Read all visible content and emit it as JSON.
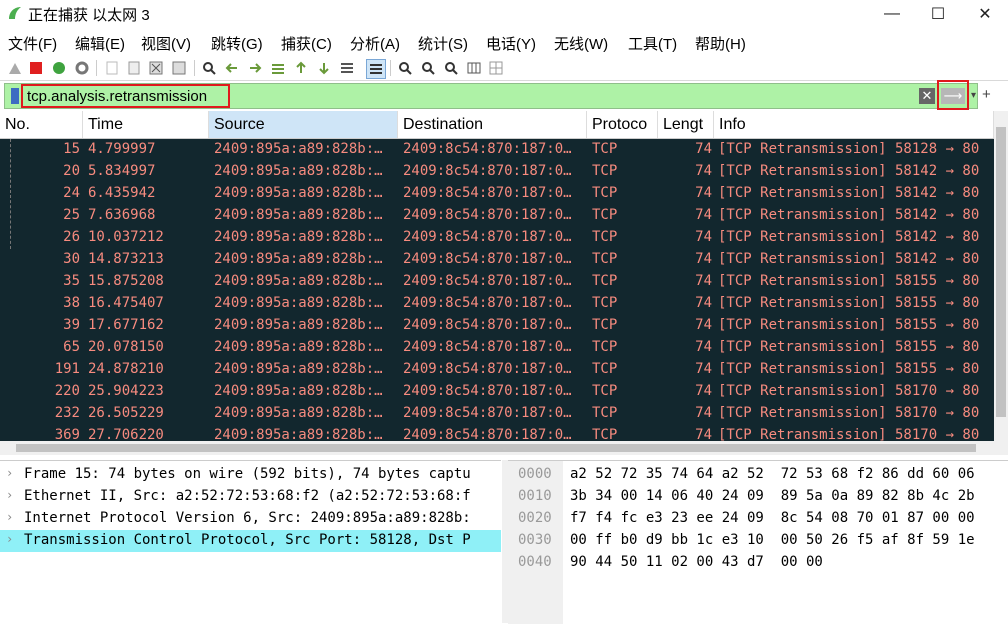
{
  "window": {
    "title": "正在捕获 以太网 3",
    "minimize": "—",
    "maximize": "☐",
    "close": "✕"
  },
  "menu": [
    "文件(F)",
    "编辑(E)",
    "视图(V)",
    "跳转(G)",
    "捕获(C)",
    "分析(A)",
    "统计(S)",
    "电话(Y)",
    "无线(W)",
    "工具(T)",
    "帮助(H)"
  ],
  "toolbar_icons": [
    "shark-fin-start-icon",
    "stop-icon",
    "restart-icon",
    "options-gear-icon",
    "open-file-icon",
    "save-file-icon",
    "close-file-icon",
    "reload-icon",
    "search-icon",
    "back-arrow-icon",
    "forward-arrow-icon",
    "goto-packet-icon",
    "first-packet-icon",
    "last-packet-icon",
    "autoscroll-icon",
    "colorize-icon",
    "zoom-in-icon",
    "zoom-out-icon",
    "zoom-reset-icon",
    "resize-columns-icon",
    "layout-icon"
  ],
  "filter": {
    "value": "tcp.analysis.retransmission",
    "clear_glyph": "✕",
    "apply_glyph": "⟶",
    "dropdown_glyph": "▾",
    "add_glyph": "+"
  },
  "colors": {
    "filter_bg": "#aef2a6",
    "row_bg": "#12272e",
    "row_fg": "#f78b7f",
    "selected_detail_bg": "#8ff0f7",
    "highlight_box": "#e0191d"
  },
  "columns": [
    "No.",
    "Time",
    "Source",
    "Destination",
    "Protoco",
    "Lengt",
    "Info"
  ],
  "packets": [
    {
      "no": "15",
      "time": "4.799997",
      "source": "2409:895a:a89:828b:…",
      "destination": "2409:8c54:870:187:0…",
      "protocol": "TCP",
      "length": "74",
      "info": "[TCP Retransmission] 58128 → 80"
    },
    {
      "no": "20",
      "time": "5.834997",
      "source": "2409:895a:a89:828b:…",
      "destination": "2409:8c54:870:187:0…",
      "protocol": "TCP",
      "length": "74",
      "info": "[TCP Retransmission] 58142 → 80"
    },
    {
      "no": "24",
      "time": "6.435942",
      "source": "2409:895a:a89:828b:…",
      "destination": "2409:8c54:870:187:0…",
      "protocol": "TCP",
      "length": "74",
      "info": "[TCP Retransmission] 58142 → 80"
    },
    {
      "no": "25",
      "time": "7.636968",
      "source": "2409:895a:a89:828b:…",
      "destination": "2409:8c54:870:187:0…",
      "protocol": "TCP",
      "length": "74",
      "info": "[TCP Retransmission] 58142 → 80"
    },
    {
      "no": "26",
      "time": "10.037212",
      "source": "2409:895a:a89:828b:…",
      "destination": "2409:8c54:870:187:0…",
      "protocol": "TCP",
      "length": "74",
      "info": "[TCP Retransmission] 58142 → 80"
    },
    {
      "no": "30",
      "time": "14.873213",
      "source": "2409:895a:a89:828b:…",
      "destination": "2409:8c54:870:187:0…",
      "protocol": "TCP",
      "length": "74",
      "info": "[TCP Retransmission] 58142 → 80"
    },
    {
      "no": "35",
      "time": "15.875208",
      "source": "2409:895a:a89:828b:…",
      "destination": "2409:8c54:870:187:0…",
      "protocol": "TCP",
      "length": "74",
      "info": "[TCP Retransmission] 58155 → 80"
    },
    {
      "no": "38",
      "time": "16.475407",
      "source": "2409:895a:a89:828b:…",
      "destination": "2409:8c54:870:187:0…",
      "protocol": "TCP",
      "length": "74",
      "info": "[TCP Retransmission] 58155 → 80"
    },
    {
      "no": "39",
      "time": "17.677162",
      "source": "2409:895a:a89:828b:…",
      "destination": "2409:8c54:870:187:0…",
      "protocol": "TCP",
      "length": "74",
      "info": "[TCP Retransmission] 58155 → 80"
    },
    {
      "no": "65",
      "time": "20.078150",
      "source": "2409:895a:a89:828b:…",
      "destination": "2409:8c54:870:187:0…",
      "protocol": "TCP",
      "length": "74",
      "info": "[TCP Retransmission] 58155 → 80"
    },
    {
      "no": "191",
      "time": "24.878210",
      "source": "2409:895a:a89:828b:…",
      "destination": "2409:8c54:870:187:0…",
      "protocol": "TCP",
      "length": "74",
      "info": "[TCP Retransmission] 58155 → 80"
    },
    {
      "no": "220",
      "time": "25.904223",
      "source": "2409:895a:a89:828b:…",
      "destination": "2409:8c54:870:187:0…",
      "protocol": "TCP",
      "length": "74",
      "info": "[TCP Retransmission] 58170 → 80"
    },
    {
      "no": "232",
      "time": "26.505229",
      "source": "2409:895a:a89:828b:…",
      "destination": "2409:8c54:870:187:0…",
      "protocol": "TCP",
      "length": "74",
      "info": "[TCP Retransmission] 58170 → 80"
    },
    {
      "no": "369",
      "time": "27.706220",
      "source": "2409:895a:a89:828b:…",
      "destination": "2409:8c54:870:187:0…",
      "protocol": "TCP",
      "length": "74",
      "info": "[TCP Retransmission] 58170 → 80"
    }
  ],
  "details": [
    {
      "text": "Frame 15: 74 bytes on wire (592 bits), 74 bytes captu",
      "selected": false
    },
    {
      "text": "Ethernet II, Src: a2:52:72:53:68:f2 (a2:52:72:53:68:f",
      "selected": false
    },
    {
      "text": "Internet Protocol Version 6, Src: 2409:895a:a89:828b:",
      "selected": false
    },
    {
      "text": "Transmission Control Protocol, Src Port: 58128, Dst P",
      "selected": true
    }
  ],
  "bytes": [
    {
      "offset": "0000",
      "hex": "a2 52 72 35 74 64 a2 52  72 53 68 f2 86 dd 60 06"
    },
    {
      "offset": "0010",
      "hex": "3b 34 00 14 06 40 24 09  89 5a 0a 89 82 8b 4c 2b"
    },
    {
      "offset": "0020",
      "hex": "f7 f4 fc e3 23 ee 24 09  8c 54 08 70 01 87 00 00"
    },
    {
      "offset": "0030",
      "hex": "00 ff b0 d9 bb 1c e3 10  00 50 26 f5 af 8f 59 1e"
    },
    {
      "offset": "0040",
      "hex": "90 44 50 11 02 00 43 d7  00 00"
    }
  ]
}
